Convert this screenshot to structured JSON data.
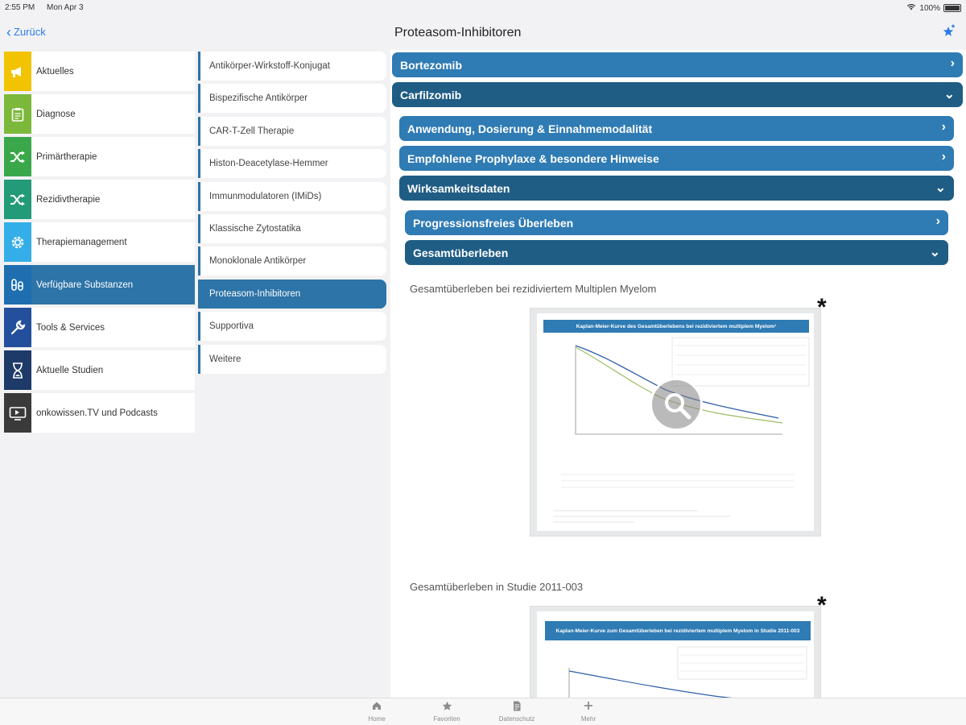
{
  "status": {
    "time": "2:55 PM",
    "date": "Mon Apr 3",
    "battery": "100%"
  },
  "nav": {
    "back_label": "Zurück",
    "title": "Proteasom-Inhibitoren"
  },
  "categories": [
    {
      "label": "Aktuelles",
      "icon": "megaphone-icon",
      "color": "#f2c300"
    },
    {
      "label": "Diagnose",
      "icon": "clipboard-icon",
      "color": "#7cb83a"
    },
    {
      "label": "Primärtherapie",
      "icon": "shuffle-icon",
      "color": "#3aa84a"
    },
    {
      "label": "Rezidivtherapie",
      "icon": "shuffle-icon",
      "color": "#239a78"
    },
    {
      "label": "Therapiemanagement",
      "icon": "gear-icon",
      "color": "#33aee8"
    },
    {
      "label": "Verfügbare Substanzen",
      "icon": "vial-icon",
      "color": "#1f6fb0"
    },
    {
      "label": "Tools & Services",
      "icon": "wrench-icon",
      "color": "#244f9c"
    },
    {
      "label": "Aktuelle Studien",
      "icon": "hourglass-icon",
      "color": "#1e3a68"
    },
    {
      "label": "onkowissen.TV und Podcasts",
      "icon": "tv-icon",
      "color": "#3a3a3a"
    }
  ],
  "subcategories": [
    "Antikörper-Wirkstoff-Konjugat",
    "Bispezifische Antikörper",
    "CAR-T-Zell Therapie",
    "Histon-Deacetylase-Hemmer",
    "Immunmodulatoren (IMiDs)",
    "Klassische Zytostatika",
    "Monoklonale Antikörper",
    "Proteasom-Inhibitoren",
    "Supportiva",
    "Weitere"
  ],
  "content": {
    "drug1": "Bortezomib",
    "drug2": "Carfilzomib",
    "section1": "Anwendung, Dosierung & Einnahmemodalität",
    "section2": "Empfohlene Prophylaxe & besondere Hinweise",
    "section3": "Wirksamkeitsdaten",
    "sub1": "Progressionsfreies Überleben",
    "sub2": "Gesamtüberleben",
    "caption1": "Gesamtüberleben bei rezidiviertem Multiplen Myelom",
    "caption2": "Gesamtüberleben in Studie 2011-003",
    "asterisk": "*",
    "figure1_title": "Kaplan-Meier-Kurve des Gesamtüberlebens bei rezidiviertem multiplem Myelom¹",
    "figure2_title": "Kaplan-Meier-Kurve zum Gesamtüberleben bei rezidiviertem multiplem Myelom in Studie 2011-003"
  },
  "tabs": [
    {
      "label": "Home",
      "icon": "home-icon"
    },
    {
      "label": "Favoriten",
      "icon": "star-icon"
    },
    {
      "label": "Datenschutz",
      "icon": "document-icon"
    },
    {
      "label": "Mehr",
      "icon": "plus-icon"
    }
  ],
  "colors": {
    "accent": "#2f7bb4",
    "accent_dark": "#1f5d85",
    "link": "#2b7de9"
  }
}
